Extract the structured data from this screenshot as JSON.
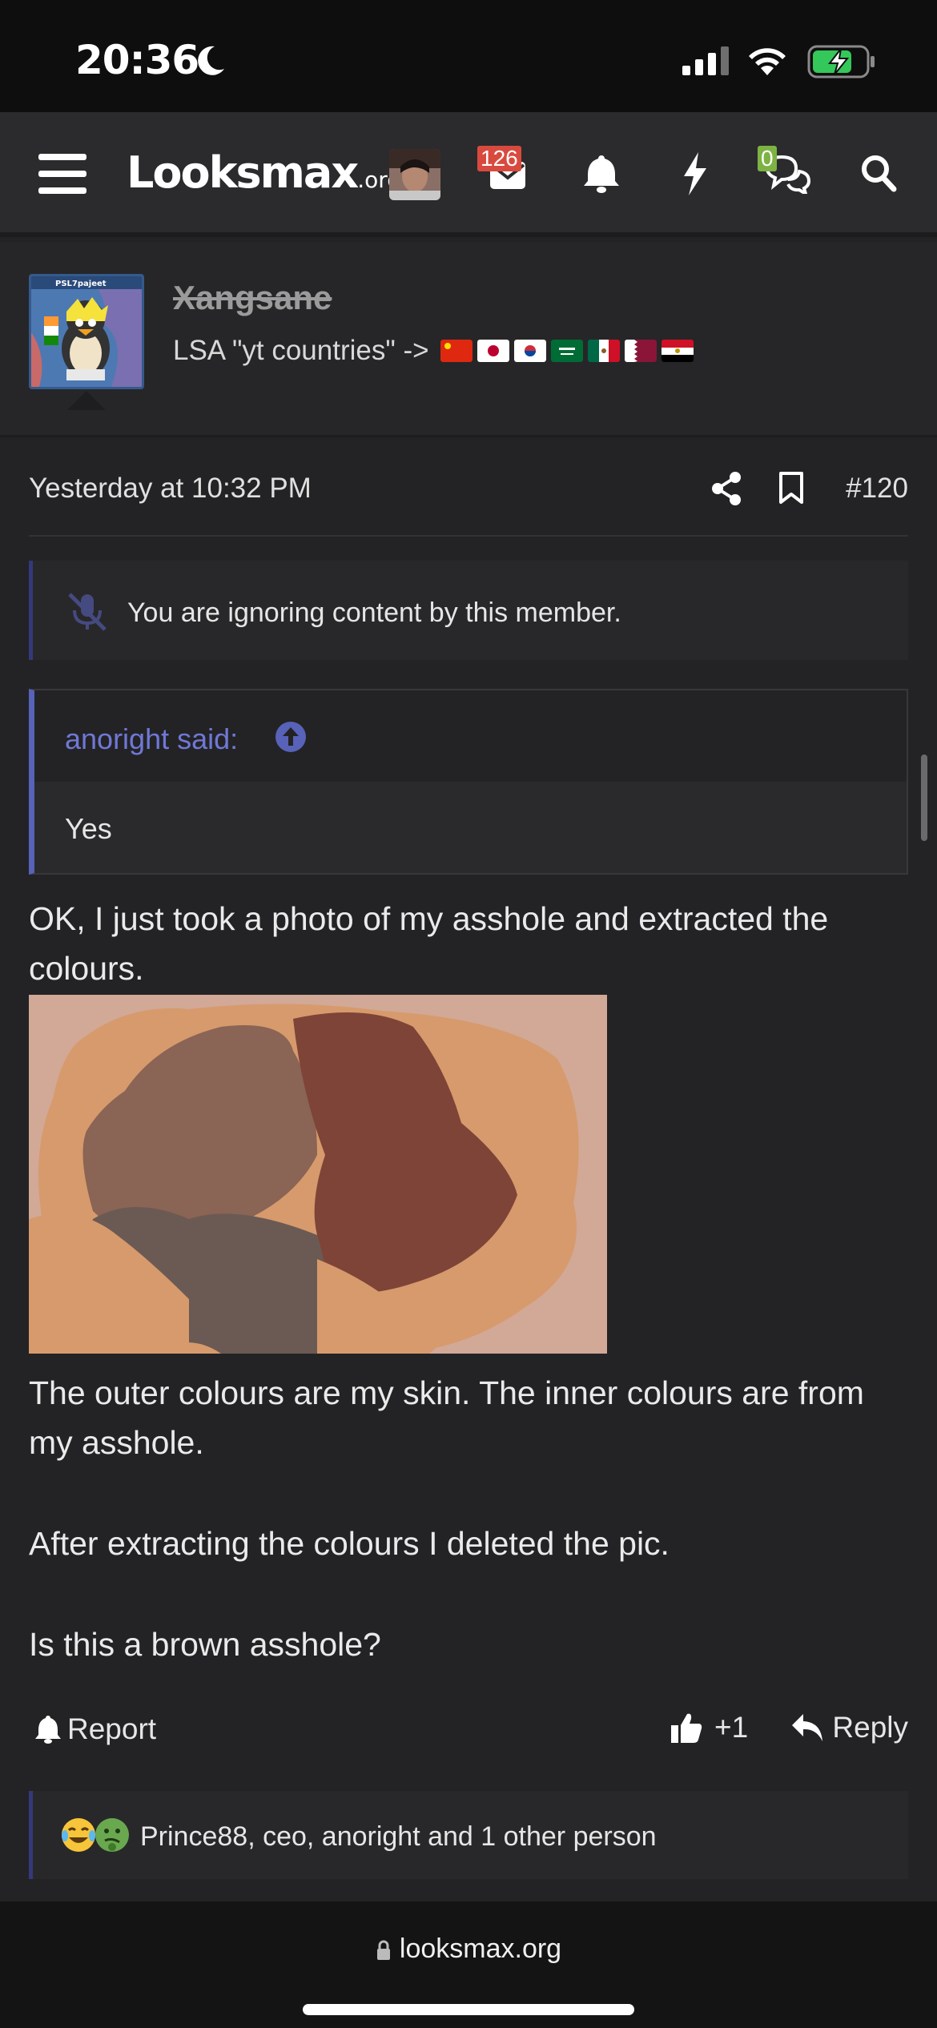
{
  "status_bar": {
    "time": "20:36"
  },
  "nav": {
    "logo_main": "Looksmax",
    "logo_suffix": ".org",
    "inbox_count": "126",
    "conversations_count": "0"
  },
  "post": {
    "username": "Xangsane",
    "user_title": "LSA \"yt countries\" ->",
    "avatar_label": "PSL7pajeet",
    "date": "Yesterday at 10:32 PM",
    "number": "#120",
    "ignored_notice": "You are ignoring content by this member.",
    "quote": {
      "author": "anoright said:",
      "text": "Yes"
    },
    "paragraphs": [
      "OK, I just took a photo of my asshole and extracted the colours.",
      "The outer colours are my skin. The inner colours are from my asshole.",
      "After extracting the colours I deleted the pic.",
      "Is this a brown asshole?"
    ],
    "actions": {
      "report": "Report",
      "like_count": "+1",
      "reply": "Reply"
    },
    "reactions_text": "Prince88, ceo, anoright and 1 other person"
  },
  "browser": {
    "url": "looksmax.org"
  },
  "colors": {
    "background": "#232325",
    "accent": "#5762b8",
    "badge_red": "#d94a3e",
    "badge_green": "#7cb342",
    "image_skin": "#d9ab97",
    "image_mid": "#8a6455",
    "image_dark_red": "#7e4438",
    "image_brown": "#6b5a53"
  }
}
